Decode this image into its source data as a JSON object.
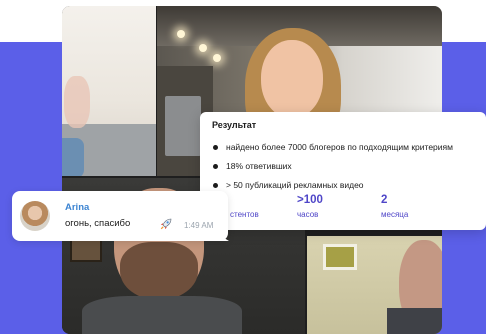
{
  "colors": {
    "background_band": "#5b5fe8",
    "stat_accent": "#4f46c8",
    "sender_name": "#3c84d2"
  },
  "result_card": {
    "title": "Результат",
    "items": [
      "найдено более 7000 блогеров по подходящим критериям",
      "18% ответивших",
      "> 50 публикаций рекламных видео"
    ],
    "stats": [
      {
        "value": "",
        "label": "стентов"
      },
      {
        "value": ">100",
        "label": "часов"
      },
      {
        "value": "2",
        "label": "месяца"
      }
    ]
  },
  "chat": {
    "sender": "Arina",
    "message": "огонь, спасибо",
    "emoji_icon": "rocket-icon",
    "time": "1:49 AM"
  }
}
